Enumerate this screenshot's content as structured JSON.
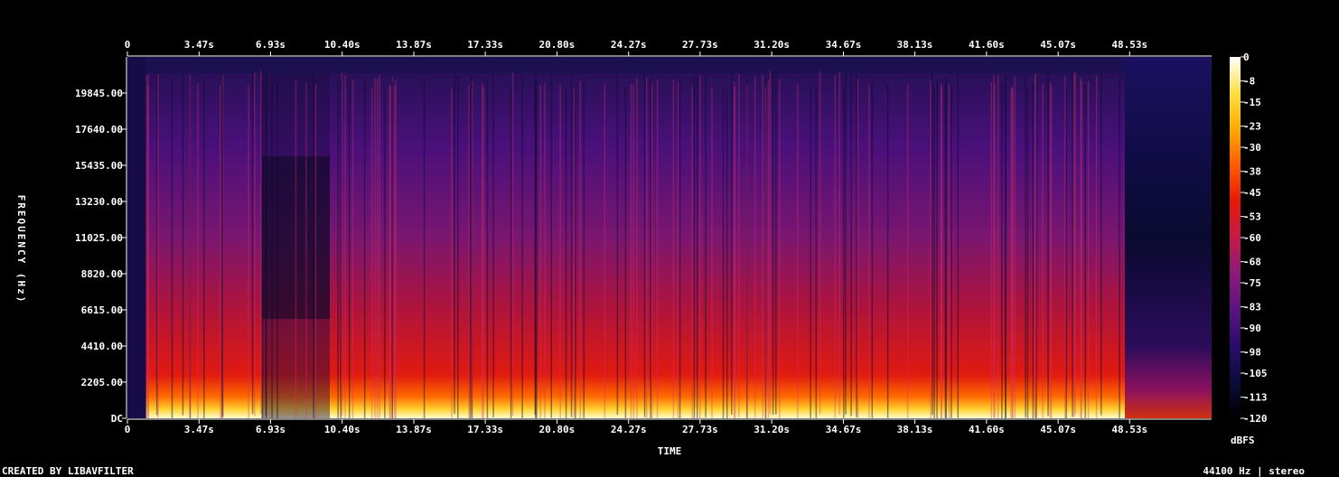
{
  "chart_data": {
    "type": "heatmap",
    "title": "",
    "xlabel": "TIME",
    "ylabel": "FREQUENCY (Hz)",
    "x_ticks": [
      "0",
      "3.47s",
      "6.93s",
      "10.40s",
      "13.87s",
      "17.33s",
      "20.80s",
      "24.27s",
      "27.73s",
      "31.20s",
      "34.67s",
      "38.13s",
      "41.60s",
      "45.07s",
      "48.53s"
    ],
    "x_tick_values": [
      0,
      3.47,
      6.93,
      10.4,
      13.87,
      17.33,
      20.8,
      24.27,
      27.73,
      31.2,
      34.67,
      38.13,
      41.6,
      45.07,
      48.53
    ],
    "xlim": [
      0,
      52.5
    ],
    "y_ticks": [
      "DC",
      "2205.00",
      "4410.00",
      "6615.00",
      "8820.00",
      "11025.00",
      "13230.00",
      "15435.00",
      "17640.00",
      "19845.00"
    ],
    "y_tick_values": [
      0,
      2205,
      4410,
      6615,
      8820,
      11025,
      13230,
      15435,
      17640,
      19845
    ],
    "ylim": [
      0,
      22050
    ],
    "colorbar": {
      "label": "dBFS",
      "ticks": [
        "0",
        "-8",
        "-15",
        "-23",
        "-30",
        "-38",
        "-45",
        "-53",
        "-60",
        "-68",
        "-75",
        "-83",
        "-90",
        "-98",
        "-105",
        "-113",
        "-120"
      ],
      "tick_values": [
        0,
        -8,
        -15,
        -23,
        -30,
        -38,
        -45,
        -53,
        -60,
        -68,
        -75,
        -83,
        -90,
        -98,
        -105,
        -113,
        -120
      ],
      "range": [
        -120,
        0
      ],
      "colors": [
        "#000000",
        "#0c0c3a",
        "#2a0c6a",
        "#5a1480",
        "#8c1a7a",
        "#c41a48",
        "#e81808",
        "#ff5a00",
        "#ffaa00",
        "#ffe040",
        "#ffffff"
      ]
    },
    "signal": {
      "start_s": 0.9,
      "end_s": 48.3,
      "fade_end_s": 50.0,
      "loud_spans_s": [
        [
          0.9,
          6.5
        ],
        [
          9.8,
          48.3
        ]
      ],
      "quiet_span_s": [
        6.5,
        9.8
      ],
      "energy_profile": "bright yellow-white energy below ~1 kHz, red through ~8 kHz, purple above, dark blue near 22 kHz; tail after 48.5s decays to dark blue with low-frequency red"
    }
  },
  "footer": {
    "credit": "CREATED BY LIBAVFILTER",
    "format": "44100 Hz | stereo"
  }
}
